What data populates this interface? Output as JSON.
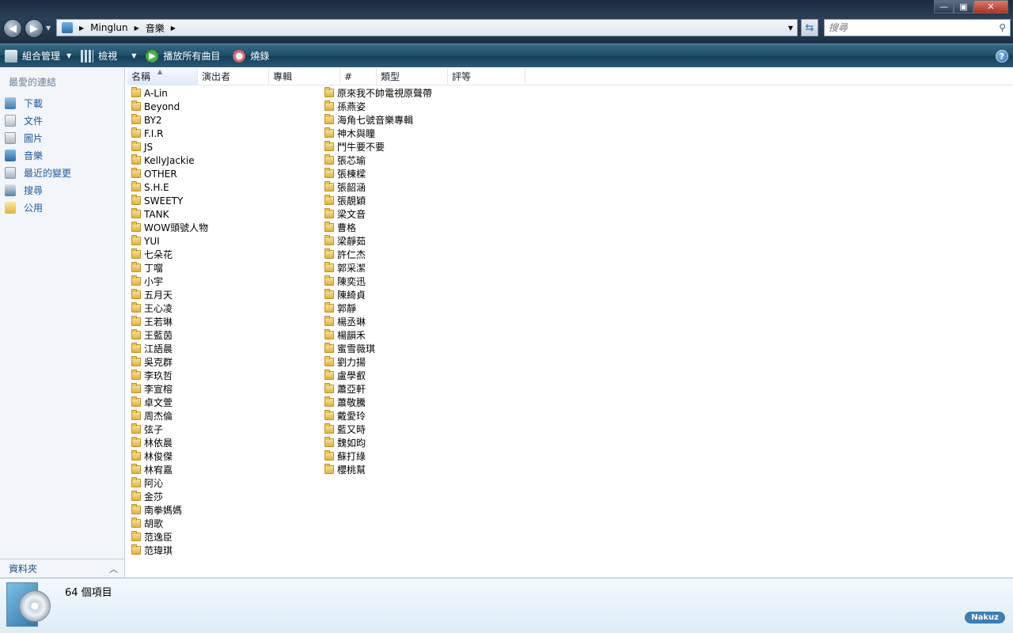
{
  "window": {
    "min_glyph": "—",
    "max_glyph": "▣",
    "close_glyph": "✕"
  },
  "address_bar": {
    "crumbs": [
      "Minglun",
      "音樂"
    ],
    "search_placeholder": "搜尋"
  },
  "toolbar": {
    "organize_label": "組合管理",
    "views_label": "檢視",
    "play_all_label": "播放所有曲目",
    "burn_label": "燒錄",
    "help_glyph": "?"
  },
  "nav_pane": {
    "favorites_title": "最愛的連結",
    "items": [
      {
        "label": "下載",
        "icon": "download-icon"
      },
      {
        "label": "文件",
        "icon": "document-icon"
      },
      {
        "label": "圖片",
        "icon": "picture-icon"
      },
      {
        "label": "音樂",
        "icon": "music-icon"
      },
      {
        "label": "最近的變更",
        "icon": "recent-icon"
      },
      {
        "label": "搜尋",
        "icon": "search-icon"
      },
      {
        "label": "公用",
        "icon": "public-folder-icon"
      }
    ],
    "folders_label": "資料夾"
  },
  "columns": {
    "name": "名稱",
    "artist": "演出者",
    "album": "專輯",
    "number": "#",
    "type": "類型",
    "rating": "評等"
  },
  "files_col_a": [
    "A-Lin",
    "Beyond",
    "BY2",
    "F.I.R",
    "JS",
    "KellyJackie",
    "OTHER",
    "S.H.E",
    "SWEETY",
    "TANK",
    "WOW頭號人物",
    "YUI",
    "七朵花",
    "丁噹",
    "小宇",
    "五月天",
    "王心凌",
    "王若琳",
    "王藍茵",
    "江語晨",
    "吳克群",
    "李玖哲",
    "李宣榕",
    "卓文萱",
    "周杰倫",
    "弦子",
    "林依晨",
    "林俊傑",
    "林宥嘉",
    "阿沁",
    "金莎",
    "南拳媽媽",
    "胡歌",
    "范逸臣",
    "范瑋琪"
  ],
  "files_col_b": [
    "原來我不帥電視原聲帶",
    "孫燕姿",
    "海角七號音樂專輯",
    "神木與瞳",
    "鬥牛要不要",
    "張芯瑜",
    "張棟樑",
    "張韶涵",
    "張靚穎",
    "梁文音",
    "曹格",
    "梁靜茹",
    "許仁杰",
    "郭采潔",
    "陳奕迅",
    "陳綺貞",
    "郭靜",
    "楊丞琳",
    "楊韻禾",
    "蜜雪薇琪",
    "劉力揚",
    "盧學叡",
    "蕭亞軒",
    "蕭敬騰",
    "戴愛玲",
    "藍又時",
    "魏如昀",
    "蘇打綠",
    "櫻桃幫"
  ],
  "details": {
    "count_text": "64 個項目",
    "brand": "Nakuz"
  }
}
